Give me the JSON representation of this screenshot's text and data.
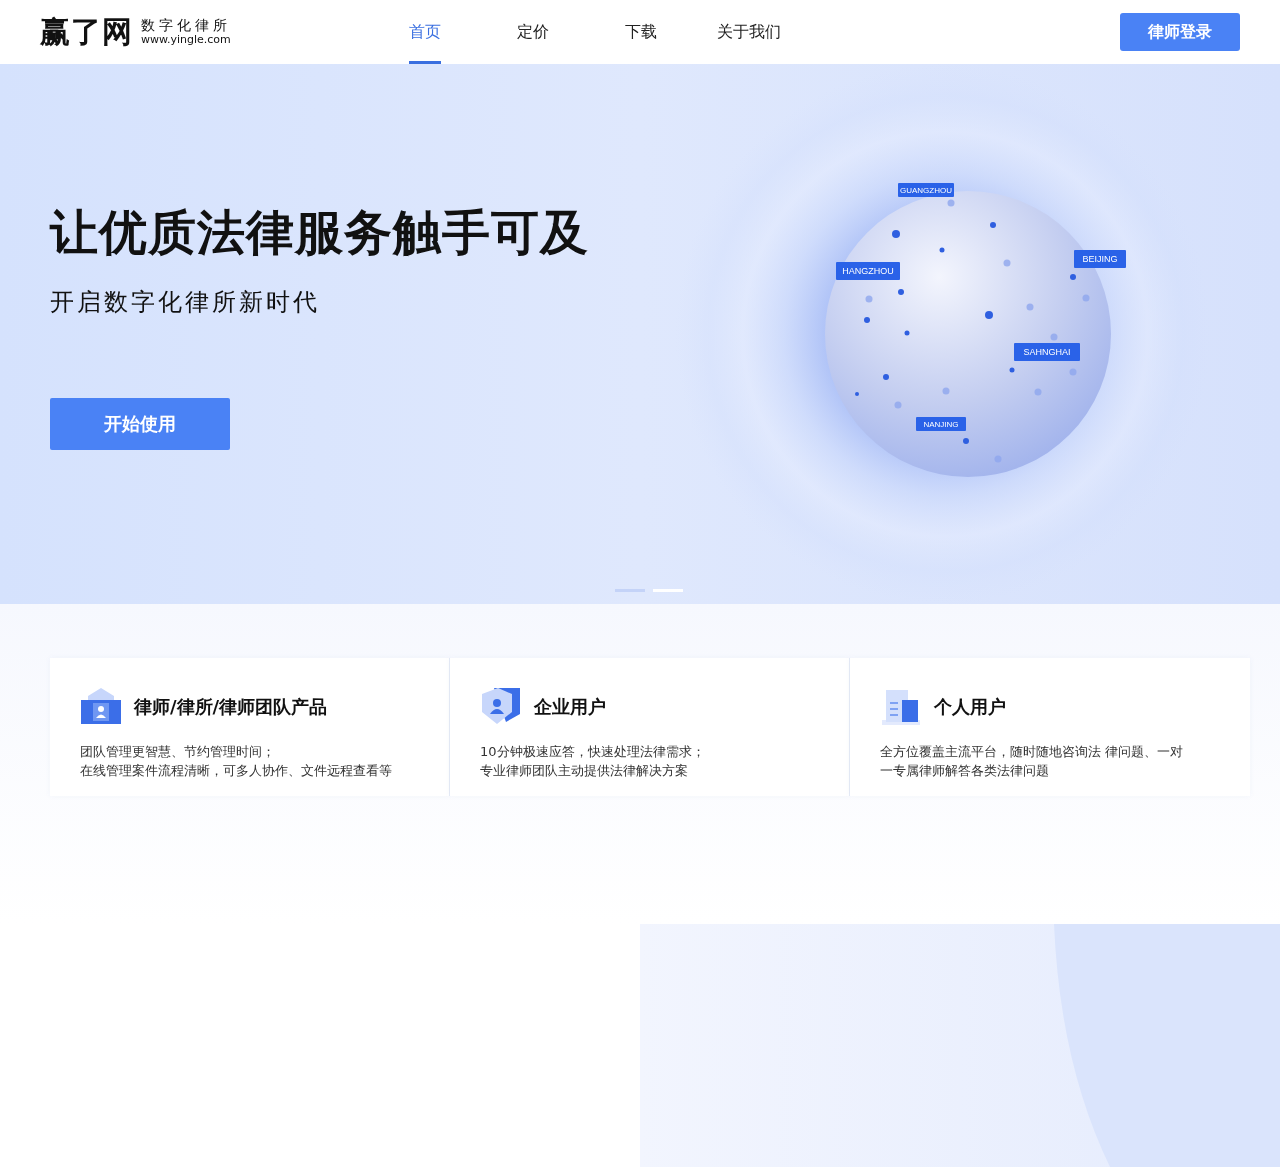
{
  "header": {
    "logo_mark": "赢了网",
    "logo_tagline": "数字化律所",
    "logo_url": "www.yingle.com",
    "nav": [
      {
        "label": "首页",
        "selected": true
      },
      {
        "label": "定价",
        "selected": false
      },
      {
        "label": "下载",
        "selected": false
      },
      {
        "label": "关于我们",
        "selected": false
      }
    ],
    "login_button": "律师登录"
  },
  "hero": {
    "title": "让优质法律服务触手可及",
    "subtitle": "开启数字化律所新时代",
    "cta": "开始使用",
    "cities": [
      "GUANGZHOU",
      "HANGZHOU",
      "BEIJING",
      "SAHNGHAI",
      "NANJING"
    ],
    "slides": [
      {
        "selected": false
      },
      {
        "selected": true
      }
    ]
  },
  "features": [
    {
      "title": "律师/律所/律师团队产品",
      "lines": [
        "团队管理更智慧、节约管理时间；",
        "在线管理案件流程清晰，可多人协作、文件远程查看等"
      ]
    },
    {
      "title": "企业用户",
      "lines": [
        "10分钟极速应答，快速处理法律需求；",
        "专业律师团队主动提供法律解决方案"
      ]
    },
    {
      "title": "个人用户",
      "lines": [
        "全方位覆盖主流平台，随时随地咨询法 律问题、一对",
        "一专属律师解答各类法律问题"
      ]
    }
  ]
}
